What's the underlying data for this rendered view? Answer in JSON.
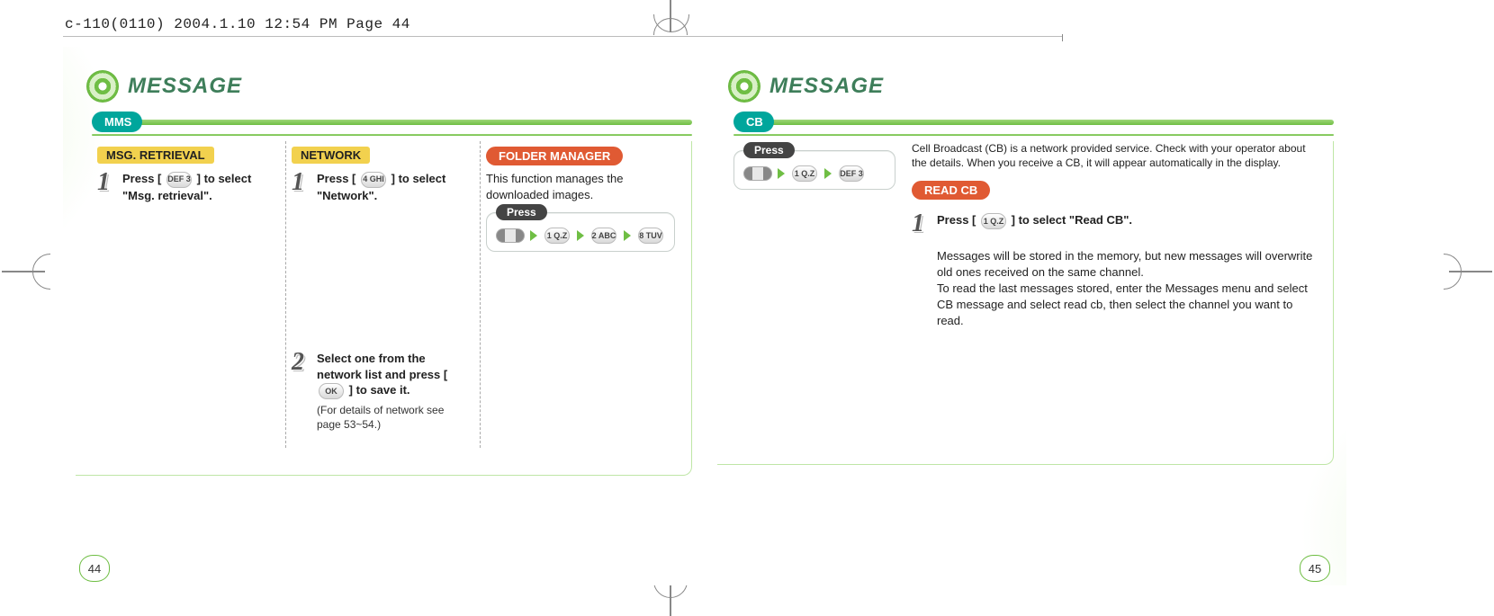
{
  "meta": {
    "crop_tag": "c-110(0110)  2004.1.10  12:54 PM  Page 44"
  },
  "left": {
    "header": "MESSAGE",
    "tab": "MMS",
    "page_number": "44",
    "columns": {
      "msg_retrieval": {
        "title": "MSG. RETRIEVAL",
        "step1_pre": "Press [",
        "step1_key": "DEF 3",
        "step1_post": "] to select \"Msg. retrieval\"."
      },
      "network": {
        "title": "NETWORK",
        "step1_pre": "Press [",
        "step1_key": "4 GHI",
        "step1_post": "] to select \"Network\".",
        "step2_pre": "Select one from the network list and press [",
        "step2_key": "OK",
        "step2_post": "] to save it.",
        "step2_fine": "(For details of network see page 53~54.)"
      },
      "folder_manager": {
        "title": "FOLDER MANAGER",
        "desc": "This function manages the downloaded images.",
        "press_label": "Press",
        "seq": [
          "menu",
          "1 Q.Z",
          "2 ABC",
          "8 TUV"
        ]
      }
    }
  },
  "right": {
    "header": "MESSAGE",
    "tab": "CB",
    "page_number": "45",
    "press_label": "Press",
    "press_seq": [
      "menu",
      "1 Q.Z",
      "DEF 3"
    ],
    "intro": "Cell Broadcast (CB) is a network provided service. Check with your operator about the details. When you receive a CB, it will appear automatically in the display.",
    "read_cb": {
      "title": "READ CB",
      "step1_pre": "Press [",
      "step1_key": "1 Q.Z",
      "step1_post": "] to select \"Read CB\".",
      "note": "Messages will be stored in the memory, but new messages will overwrite old ones received on the same channel.\nTo read the last messages stored, enter the Messages menu and select CB message and select read cb, then select the channel you want to read."
    }
  }
}
